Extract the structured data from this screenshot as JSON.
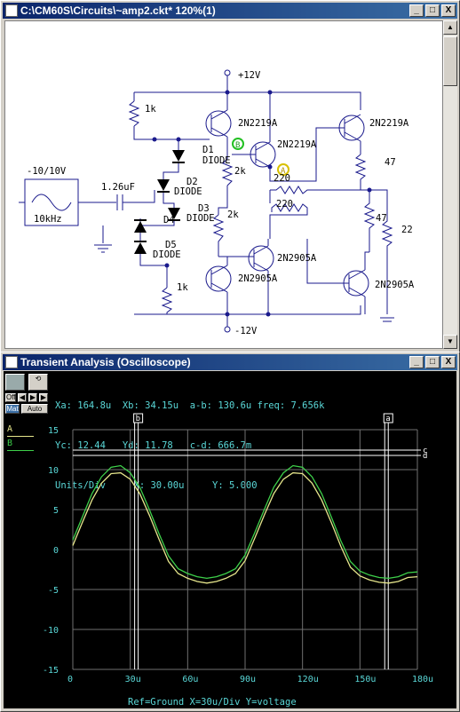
{
  "schematic_window": {
    "title": "C:\\CM60S\\Circuits\\~amp2.ckt* 120%(1)",
    "buttons": [
      "_",
      "□",
      "X"
    ]
  },
  "schematic": {
    "supply_pos": "+12V",
    "supply_neg": "-12V",
    "source_label": "-10/10V",
    "source_freq": "10kHz",
    "capacitor": "1.26uF",
    "resistors": {
      "r_top_left": "1k",
      "r_2k_a": "2k",
      "r_2k_b": "2k",
      "r_bottom_left": "1k",
      "r_220_a": "220",
      "r_220_b": "220",
      "r_47_a": "47",
      "r_47_b": "47",
      "r_22": "22"
    },
    "diodes": {
      "d1": "D1",
      "d2": "D2",
      "d3": "D3",
      "d4": "D4",
      "d5": "D5",
      "type": "DIODE"
    },
    "transistors": {
      "q1": "2N2219A",
      "q2": "2N2219A",
      "q3": "2N2219A",
      "q4": "2N2905A",
      "q5": "2N2905A",
      "q6": "2N2905A"
    },
    "probe_a": "A",
    "probe_b": "B"
  },
  "scope_window": {
    "title": "Transient Analysis (Oscilloscope)",
    "buttons": [
      "_",
      "□",
      "X"
    ]
  },
  "scope": {
    "line1": "Xa: 164.8u  Xb: 34.15u  a-b: 130.6u freq: 7.656k",
    "line2": "Yc: 12.44   Yd: 11.78   c-d: 666.7m",
    "line3": "Units/Div     X: 30.00u     Y: 5.000",
    "tool_labels": {
      "off": "Off",
      "auto": "Auto",
      "mat": "Mat"
    },
    "legend": [
      "A",
      "B"
    ],
    "footer": "Ref=Ground  X=30u/Div Y=voltage",
    "cursor_labels": {
      "a": "a",
      "b": "b",
      "c": "c",
      "d": "d"
    },
    "colors": {
      "A": "#e6e68c",
      "B": "#3ed04a",
      "grid": "#707070",
      "text": "#5ad8d8",
      "cursor": "#ffffff"
    }
  },
  "chart_data": {
    "type": "line",
    "xlim": [
      0,
      180
    ],
    "ylim": [
      -15,
      15
    ],
    "x_ticks": [
      "0",
      "30u",
      "60u",
      "90u",
      "120u",
      "150u",
      "180u"
    ],
    "y_ticks": [
      "15",
      "10",
      "5",
      "0",
      "-5",
      "-10",
      "-15"
    ],
    "series": [
      {
        "name": "A",
        "x": [
          0,
          5,
          10,
          15,
          20,
          25,
          30,
          35,
          40,
          45,
          50,
          55,
          60,
          65,
          70,
          75,
          80,
          85,
          90,
          95,
          100,
          105,
          110,
          115,
          120,
          125,
          130,
          135,
          140,
          145,
          150,
          155,
          160,
          165,
          170,
          175,
          180
        ],
        "y": [
          0.5,
          3.4,
          6.2,
          8.3,
          9.5,
          9.6,
          8.8,
          7.0,
          4.3,
          1.3,
          -1.5,
          -3.0,
          -3.6,
          -4.0,
          -4.2,
          -4.0,
          -3.6,
          -3.0,
          -1.4,
          1.4,
          4.3,
          7.0,
          8.8,
          9.6,
          9.5,
          8.3,
          6.2,
          3.4,
          0.4,
          -2.2,
          -3.3,
          -3.8,
          -4.1,
          -4.2,
          -4.0,
          -3.5,
          -3.4
        ]
      },
      {
        "name": "B",
        "x": [
          0,
          5,
          10,
          15,
          20,
          25,
          30,
          35,
          40,
          45,
          50,
          55,
          60,
          65,
          70,
          75,
          80,
          85,
          90,
          95,
          100,
          105,
          110,
          115,
          120,
          125,
          130,
          135,
          140,
          145,
          150,
          155,
          160,
          165,
          170,
          175,
          180
        ],
        "y": [
          1.2,
          4.1,
          7.0,
          9.1,
          10.3,
          10.5,
          9.6,
          7.8,
          5.0,
          2.0,
          -0.8,
          -2.4,
          -3.0,
          -3.4,
          -3.6,
          -3.4,
          -3.0,
          -2.4,
          -0.7,
          2.1,
          5.0,
          7.8,
          9.6,
          10.5,
          10.3,
          9.1,
          7.0,
          4.1,
          1.1,
          -1.5,
          -2.7,
          -3.2,
          -3.5,
          -3.6,
          -3.4,
          -2.9,
          -2.8
        ]
      }
    ],
    "cursors": {
      "xa": 164.8,
      "xb": 34.15,
      "yc": 12.44,
      "yd": 11.78
    }
  }
}
